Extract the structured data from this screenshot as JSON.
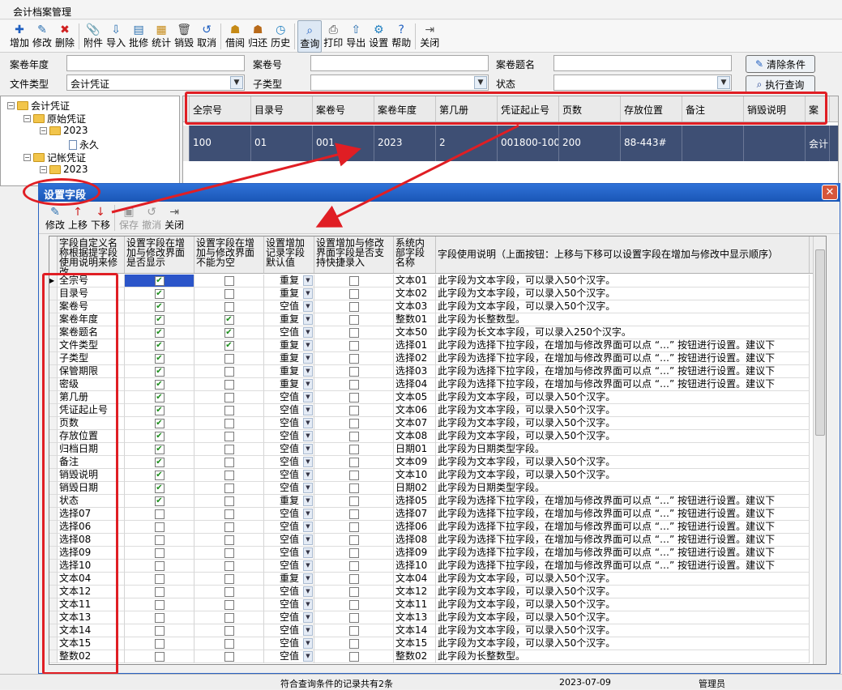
{
  "window": {
    "title": "会计档案管理"
  },
  "toolbar": {
    "items": [
      {
        "label": "增加",
        "icon": "plus-icon",
        "glyph": "✚",
        "color": "#1f5fc0"
      },
      {
        "label": "修改",
        "icon": "pencil-icon",
        "glyph": "✎",
        "color": "#2a6fb0"
      },
      {
        "label": "删除",
        "icon": "delete-x-icon",
        "glyph": "✖",
        "color": "#d02020"
      },
      {
        "label": "附件",
        "icon": "paperclip-icon",
        "glyph": "📎",
        "color": "#555"
      },
      {
        "label": "导入",
        "icon": "import-icon",
        "glyph": "⇩",
        "color": "#2a6fb0"
      },
      {
        "label": "批修",
        "icon": "batch-edit-icon",
        "glyph": "▤",
        "color": "#2a6fb0"
      },
      {
        "label": "统计",
        "icon": "statistics-icon",
        "glyph": "▦",
        "color": "#c68a16"
      },
      {
        "label": "销毁",
        "icon": "trash-icon",
        "glyph": "🗑",
        "color": "#444"
      },
      {
        "label": "取消",
        "icon": "undo-icon",
        "glyph": "↺",
        "color": "#1f5fc0"
      },
      {
        "label": "借阅",
        "icon": "borrow-icon",
        "glyph": "☗",
        "color": "#c68a16"
      },
      {
        "label": "归还",
        "icon": "return-icon",
        "glyph": "☗",
        "color": "#b86a1a"
      },
      {
        "label": "历史",
        "icon": "history-clock-icon",
        "glyph": "◷",
        "color": "#1f7fc0"
      },
      {
        "label": "查询",
        "icon": "search-icon",
        "glyph": "⌕",
        "color": "#1f5fc0"
      },
      {
        "label": "打印",
        "icon": "printer-icon",
        "glyph": "⎙",
        "color": "#444"
      },
      {
        "label": "导出",
        "icon": "export-icon",
        "glyph": "⇧",
        "color": "#2a6fb0"
      },
      {
        "label": "设置",
        "icon": "settings-gear-icon",
        "glyph": "⚙",
        "color": "#1f7fc0"
      },
      {
        "label": "帮助",
        "icon": "help-icon",
        "glyph": "?",
        "color": "#1f5fc0"
      },
      {
        "label": "关闭",
        "icon": "exit-door-icon",
        "glyph": "⇥",
        "color": "#555"
      }
    ]
  },
  "filter": {
    "year_label": "案卷年度",
    "year_value": "",
    "juan_no_label": "案卷号",
    "juan_no_value": "",
    "juan_title_label": "案卷题名",
    "juan_title_value": "",
    "file_type_label": "文件类型",
    "file_type_value": "会计凭证",
    "sub_type_label": "子类型",
    "sub_type_value": "",
    "status_label": "状态",
    "status_value": "",
    "clear_button": "清除条件",
    "query_button": "执行查询"
  },
  "tree": {
    "root": "会计凭证",
    "n1": "原始凭证",
    "n1_year": "2023",
    "n1_leaf": "永久",
    "n2": "记帐凭证",
    "n2_year": "2023"
  },
  "main_grid": {
    "headers": [
      "全宗号",
      "目录号",
      "案卷号",
      "案卷年度",
      "第几册",
      "凭证起止号",
      "页数",
      "存放位置",
      "备注",
      "销毁说明",
      "案"
    ],
    "row": [
      "100",
      "01",
      "001",
      "2023",
      "2",
      "001800-100",
      "200",
      "88-443#",
      "",
      "",
      "会计"
    ]
  },
  "dialog": {
    "title": "设置字段",
    "close_glyph": "✕",
    "toolbar": [
      {
        "label": "修改",
        "icon": "pencil-icon",
        "glyph": "✎",
        "enabled": true
      },
      {
        "label": "上移",
        "icon": "arrow-up-icon",
        "glyph": "↑",
        "enabled": true
      },
      {
        "label": "下移",
        "icon": "arrow-down-icon",
        "glyph": "↓",
        "enabled": true
      },
      {
        "label": "保存",
        "icon": "save-disk-icon",
        "glyph": "▣",
        "enabled": false
      },
      {
        "label": "撤消",
        "icon": "undo-icon",
        "glyph": "↺",
        "enabled": false
      },
      {
        "label": "关闭",
        "icon": "exit-door-icon",
        "glyph": "⇥",
        "enabled": true
      }
    ],
    "headers": {
      "col1": "字段自定义名称根据提字段使用说明来修改",
      "col2": "设置字段在增加与修改界面是否显示",
      "col3": "设置字段在增加与修改界面不能为空",
      "col4": "设置增加记录字段默认值",
      "col5": "设置增加与修改界面字段是否支持快捷录入",
      "col6": "系统内部字段名称",
      "col7": "字段使用说明（上面按钮：上移与下移可以设置字段在增加与修改中显示顺序）"
    },
    "rows": [
      {
        "name": "全宗号",
        "show": true,
        "required": false,
        "default": "重复",
        "quick": false,
        "sys": "文本01",
        "desc": "此字段为文本字段，可以录入50个汉字。"
      },
      {
        "name": "目录号",
        "show": true,
        "required": false,
        "default": "重复",
        "quick": false,
        "sys": "文本02",
        "desc": "此字段为文本字段，可以录入50个汉字。"
      },
      {
        "name": "案卷号",
        "show": true,
        "required": false,
        "default": "空值",
        "quick": false,
        "sys": "文本03",
        "desc": "此字段为文本字段，可以录入50个汉字。"
      },
      {
        "name": "案卷年度",
        "show": true,
        "required": true,
        "default": "重复",
        "quick": false,
        "sys": "整数01",
        "desc": "此字段为长整数型。"
      },
      {
        "name": "案卷题名",
        "show": true,
        "required": true,
        "default": "空值",
        "quick": false,
        "sys": "文本50",
        "desc": "此字段为长文本字段，可以录入250个汉字。"
      },
      {
        "name": "文件类型",
        "show": true,
        "required": true,
        "default": "重复",
        "quick": false,
        "sys": "选择01",
        "desc": "此字段为选择下拉字段，在增加与修改界面可以点 “…” 按钮进行设置。建议下"
      },
      {
        "name": "子类型",
        "show": true,
        "required": false,
        "default": "重复",
        "quick": false,
        "sys": "选择02",
        "desc": "此字段为选择下拉字段，在增加与修改界面可以点 “…” 按钮进行设置。建议下"
      },
      {
        "name": "保管期限",
        "show": true,
        "required": false,
        "default": "重复",
        "quick": false,
        "sys": "选择03",
        "desc": "此字段为选择下拉字段，在增加与修改界面可以点 “…” 按钮进行设置。建议下"
      },
      {
        "name": "密级",
        "show": true,
        "required": false,
        "default": "重复",
        "quick": false,
        "sys": "选择04",
        "desc": "此字段为选择下拉字段，在增加与修改界面可以点 “…” 按钮进行设置。建议下"
      },
      {
        "name": "第几册",
        "show": true,
        "required": false,
        "default": "空值",
        "quick": false,
        "sys": "文本05",
        "desc": "此字段为文本字段，可以录入50个汉字。"
      },
      {
        "name": "凭证起止号",
        "show": true,
        "required": false,
        "default": "空值",
        "quick": false,
        "sys": "文本06",
        "desc": "此字段为文本字段，可以录入50个汉字。"
      },
      {
        "name": "页数",
        "show": true,
        "required": false,
        "default": "空值",
        "quick": false,
        "sys": "文本07",
        "desc": "此字段为文本字段，可以录入50个汉字。"
      },
      {
        "name": "存放位置",
        "show": true,
        "required": false,
        "default": "空值",
        "quick": false,
        "sys": "文本08",
        "desc": "此字段为文本字段，可以录入50个汉字。"
      },
      {
        "name": "归档日期",
        "show": true,
        "required": false,
        "default": "空值",
        "quick": false,
        "sys": "日期01",
        "desc": "此字段为日期类型字段。"
      },
      {
        "name": "备注",
        "show": true,
        "required": false,
        "default": "空值",
        "quick": false,
        "sys": "文本09",
        "desc": "此字段为文本字段，可以录入50个汉字。"
      },
      {
        "name": "销毁说明",
        "show": true,
        "required": false,
        "default": "空值",
        "quick": false,
        "sys": "文本10",
        "desc": "此字段为文本字段，可以录入50个汉字。"
      },
      {
        "name": "销毁日期",
        "show": true,
        "required": false,
        "default": "空值",
        "quick": false,
        "sys": "日期02",
        "desc": "此字段为日期类型字段。"
      },
      {
        "name": "状态",
        "show": true,
        "required": false,
        "default": "重复",
        "quick": false,
        "sys": "选择05",
        "desc": "此字段为选择下拉字段，在增加与修改界面可以点 “…” 按钮进行设置。建议下"
      },
      {
        "name": "选择07",
        "show": false,
        "required": false,
        "default": "空值",
        "quick": false,
        "sys": "选择07",
        "desc": "此字段为选择下拉字段，在增加与修改界面可以点 “…” 按钮进行设置。建议下"
      },
      {
        "name": "选择06",
        "show": false,
        "required": false,
        "default": "空值",
        "quick": false,
        "sys": "选择06",
        "desc": "此字段为选择下拉字段，在增加与修改界面可以点 “…” 按钮进行设置。建议下"
      },
      {
        "name": "选择08",
        "show": false,
        "required": false,
        "default": "空值",
        "quick": false,
        "sys": "选择08",
        "desc": "此字段为选择下拉字段，在增加与修改界面可以点 “…” 按钮进行设置。建议下"
      },
      {
        "name": "选择09",
        "show": false,
        "required": false,
        "default": "空值",
        "quick": false,
        "sys": "选择09",
        "desc": "此字段为选择下拉字段，在增加与修改界面可以点 “…” 按钮进行设置。建议下"
      },
      {
        "name": "选择10",
        "show": false,
        "required": false,
        "default": "空值",
        "quick": false,
        "sys": "选择10",
        "desc": "此字段为选择下拉字段，在增加与修改界面可以点 “…” 按钮进行设置。建议下"
      },
      {
        "name": "文本04",
        "show": false,
        "required": false,
        "default": "重复",
        "quick": false,
        "sys": "文本04",
        "desc": "此字段为文本字段，可以录入50个汉字。"
      },
      {
        "name": "文本12",
        "show": false,
        "required": false,
        "default": "空值",
        "quick": false,
        "sys": "文本12",
        "desc": "此字段为文本字段，可以录入50个汉字。"
      },
      {
        "name": "文本11",
        "show": false,
        "required": false,
        "default": "空值",
        "quick": false,
        "sys": "文本11",
        "desc": "此字段为文本字段，可以录入50个汉字。"
      },
      {
        "name": "文本13",
        "show": false,
        "required": false,
        "default": "空值",
        "quick": false,
        "sys": "文本13",
        "desc": "此字段为文本字段，可以录入50个汉字。"
      },
      {
        "name": "文本14",
        "show": false,
        "required": false,
        "default": "空值",
        "quick": false,
        "sys": "文本14",
        "desc": "此字段为文本字段，可以录入50个汉字。"
      },
      {
        "name": "文本15",
        "show": false,
        "required": false,
        "default": "空值",
        "quick": false,
        "sys": "文本15",
        "desc": "此字段为文本字段，可以录入50个汉字。"
      },
      {
        "name": "整数02",
        "show": false,
        "required": false,
        "default": "空值",
        "quick": false,
        "sys": "整数02",
        "desc": "此字段为长整数型。"
      }
    ]
  },
  "status_bar": {
    "message": "符合查询条件的记录共有2条",
    "date": "2023-07-09",
    "user": "管理员"
  },
  "colors": {
    "accent_red": "#e01e24",
    "dialog_title": "#1a56b6",
    "selected_row": "#3e4f74"
  }
}
